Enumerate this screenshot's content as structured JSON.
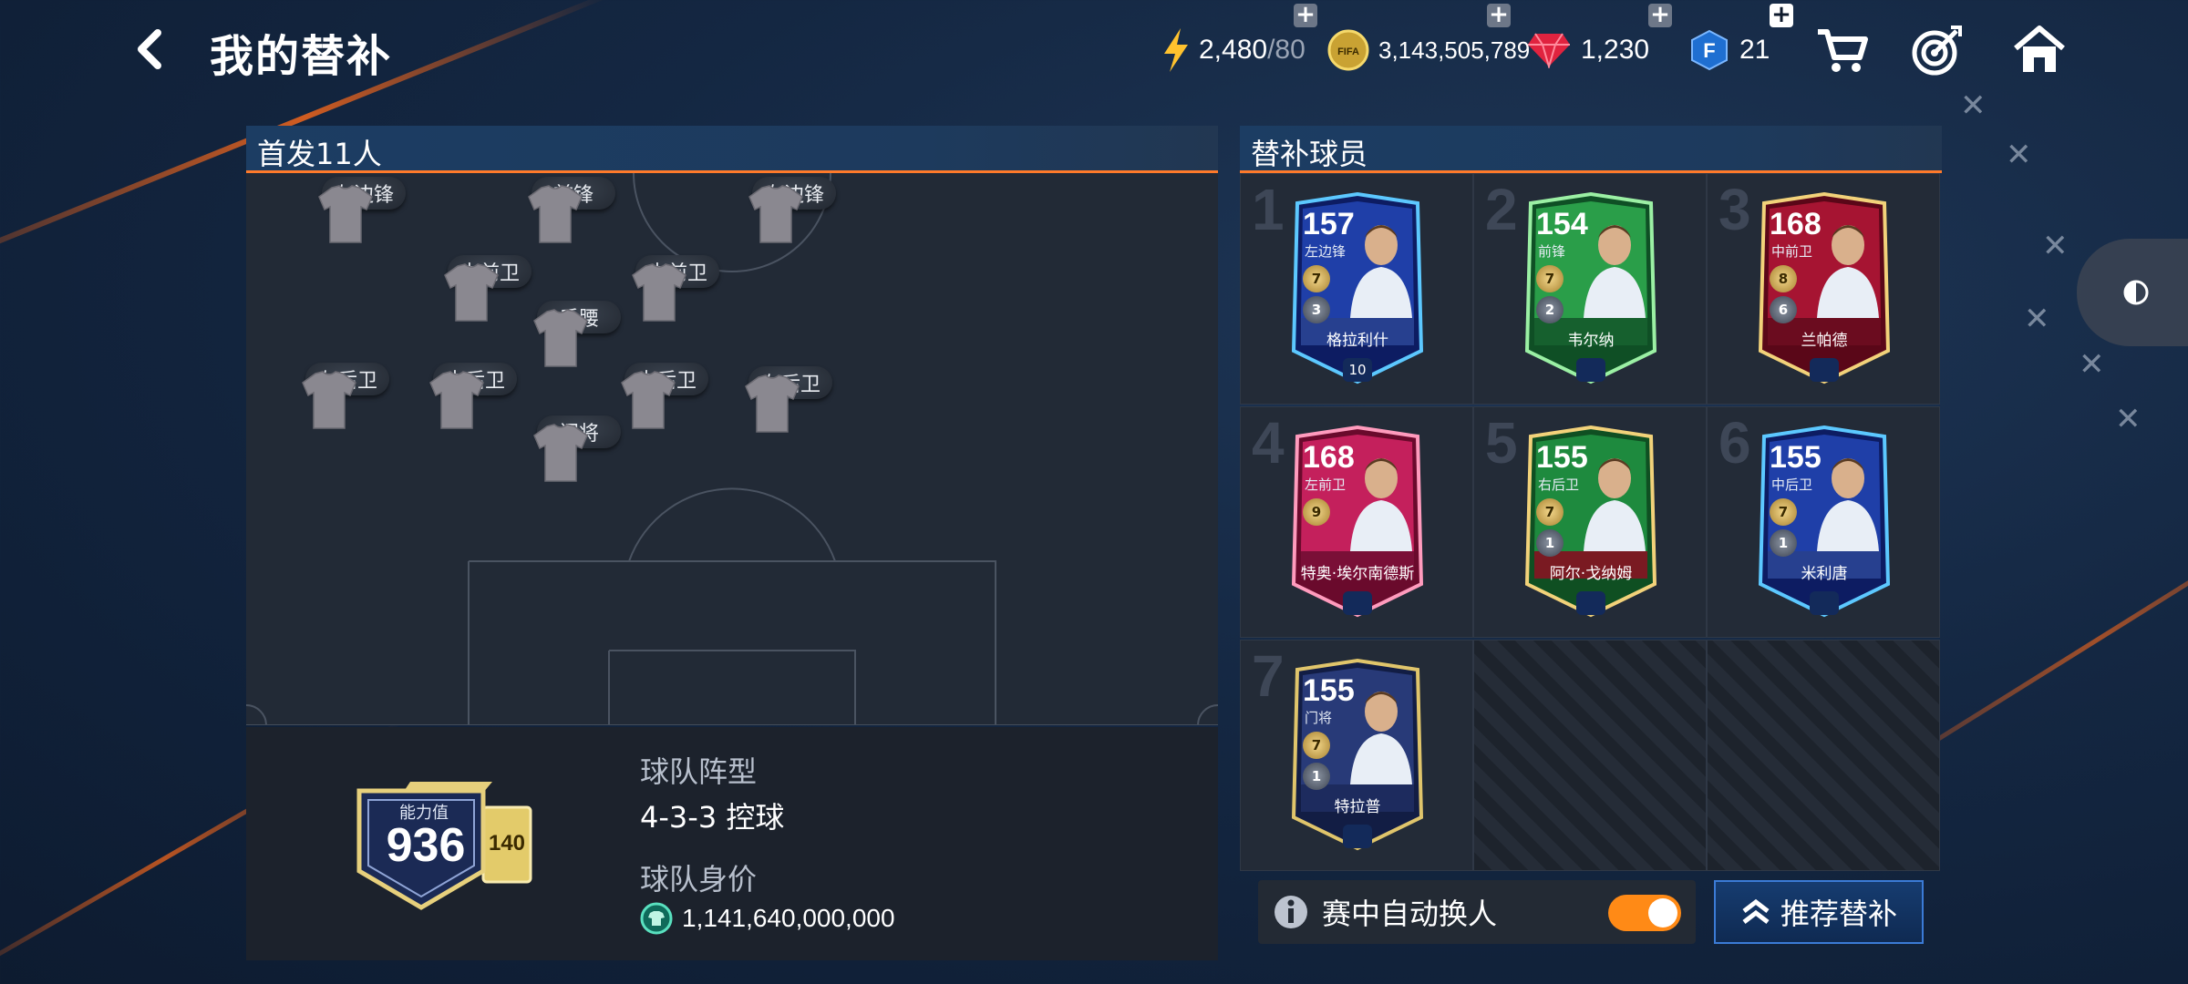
{
  "header": {
    "title": "我的替补",
    "energy": {
      "value": "2,480",
      "max": "/80"
    },
    "coins": "3,143,505,789",
    "gems": "1,230",
    "fifa_points": "21",
    "icons": [
      "back-icon",
      "energy-icon",
      "coin-icon",
      "gem-icon",
      "fifa-points-icon",
      "cart-icon",
      "target-icon",
      "home-icon"
    ]
  },
  "lineup": {
    "title": "首发11人",
    "positions": [
      {
        "label": "左边锋"
      },
      {
        "label": "前锋"
      },
      {
        "label": "右边锋"
      },
      {
        "label": "中前卫"
      },
      {
        "label": "中前卫"
      },
      {
        "label": "后腰"
      },
      {
        "label": "左后卫"
      },
      {
        "label": "中后卫"
      },
      {
        "label": "中后卫"
      },
      {
        "label": "右后卫"
      },
      {
        "label": "门将"
      }
    ]
  },
  "team": {
    "ovr_label": "能力值",
    "ovr_value": "936",
    "ovr_bonus": "140",
    "formation_label": "球队阵型",
    "formation_value": "4-3-3 控球",
    "value_label": "球队身价",
    "value_amount": "1,141,640,000,000"
  },
  "subs": {
    "title": "替补球员",
    "slots": [
      {
        "num": "1",
        "ovr": "157",
        "pos": "左边锋",
        "name": "格拉利什",
        "chip1": "7",
        "chip2": "3",
        "foot": "10",
        "theme": "blue"
      },
      {
        "num": "2",
        "ovr": "154",
        "pos": "前锋",
        "name": "韦尔纳",
        "chip1": "7",
        "chip2": "2",
        "foot": "",
        "theme": "green"
      },
      {
        "num": "3",
        "ovr": "168",
        "pos": "中前卫",
        "name": "兰帕德",
        "chip1": "8",
        "chip2": "6",
        "foot": "",
        "theme": "crimson"
      },
      {
        "num": "4",
        "ovr": "168",
        "pos": "左前卫",
        "name": "特奥·埃尔南德斯",
        "chip1": "9",
        "chip2": "",
        "foot": "",
        "theme": "pink"
      },
      {
        "num": "5",
        "ovr": "155",
        "pos": "右后卫",
        "name": "阿尔·戈纳姆",
        "chip1": "7",
        "chip2": "1",
        "foot": "",
        "theme": "saudi"
      },
      {
        "num": "6",
        "ovr": "155",
        "pos": "中后卫",
        "name": "米利唐",
        "chip1": "7",
        "chip2": "1",
        "foot": "",
        "theme": "blue"
      },
      {
        "num": "7",
        "ovr": "155",
        "pos": "门将",
        "name": "特拉普",
        "chip1": "7",
        "chip2": "1",
        "foot": "",
        "theme": "navy"
      }
    ],
    "empty_slots": 2,
    "auto_sub_label": "赛中自动换人",
    "auto_sub_on": true,
    "recommend_label": "推荐替补"
  },
  "colors": {
    "accent": "#ff7a2a",
    "toggle_on": "#ff8a16",
    "button_border": "#3b7bd6"
  }
}
